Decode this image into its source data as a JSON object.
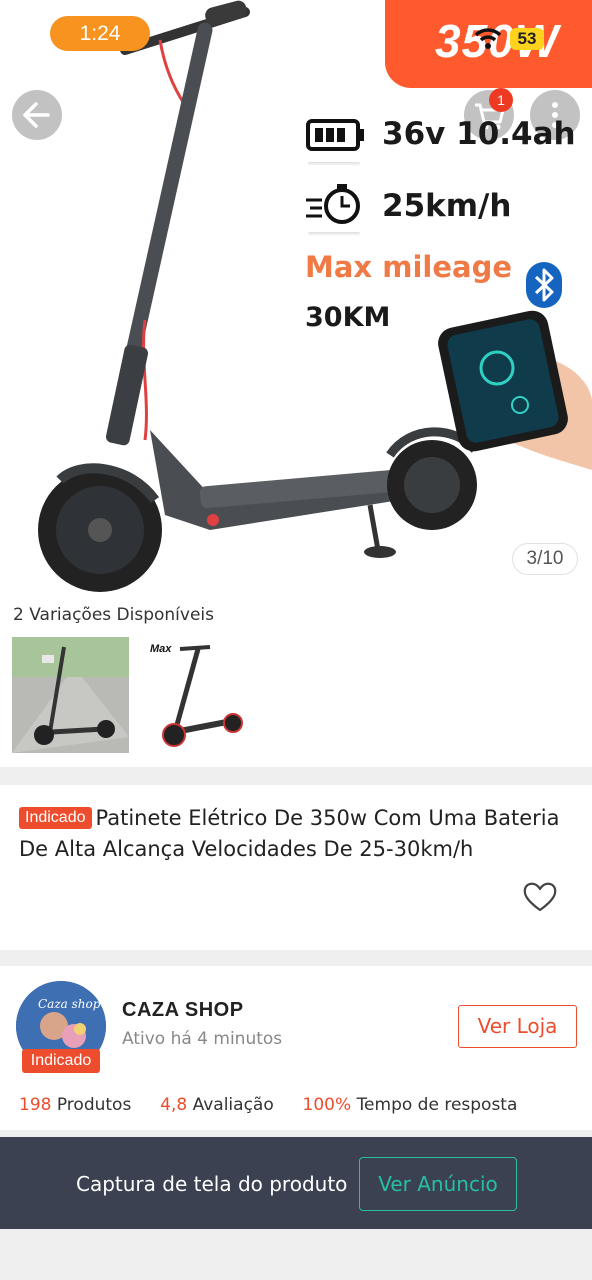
{
  "status_bar": {
    "time": "1:24",
    "battery": "53"
  },
  "hero": {
    "promo_text": "350W",
    "cart_badge": "1",
    "specs": {
      "battery": "36v 10.4ah",
      "speed": "25km/h",
      "mileage_label": "Max mileage",
      "mileage_value": "30KM"
    },
    "image_counter": "3/10"
  },
  "variations": {
    "title": "2 Variações Disponíveis",
    "items": [
      {
        "tag": ""
      },
      {
        "tag": "Max"
      }
    ]
  },
  "product": {
    "badge": "Indicado",
    "title": "Patinete Elétrico De 350w Com Uma Bateria De Alta Alcança Velocidades De 25-30km/h"
  },
  "shop": {
    "avatar_text": "Caza shop",
    "badge": "Indicado",
    "name": "CAZA SHOP",
    "active": "Ativo há 4 minutos",
    "visit_label": "Ver Loja",
    "stats": {
      "products_num": "198",
      "products_label": "Produtos",
      "rating_num": "4,8",
      "rating_label": "Avaliação",
      "response_num": "100%",
      "response_label": "Tempo de resposta"
    }
  },
  "bottom_bar": {
    "label": "Captura de tela do produto",
    "button": "Ver Anúncio"
  },
  "colors": {
    "accent": "#ee4d2d",
    "teal": "#26bfa6",
    "bar": "#3b4151",
    "promo": "#ff5a2e"
  }
}
